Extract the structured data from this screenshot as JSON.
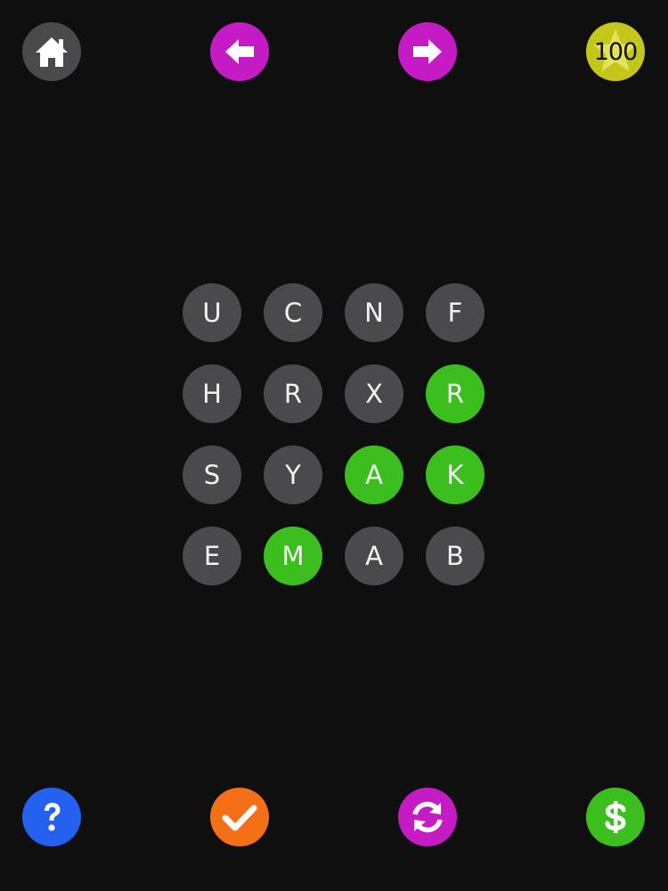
{
  "colors": {
    "background": "#0f0f10",
    "tile_default": "#4a494c",
    "tile_selected": "#3cbe1f",
    "home": "#4a494c",
    "arrows": "#c41bc4",
    "coins": "#c4c61a",
    "help": "#2561f0",
    "submit": "#f56f17",
    "shuffle": "#c41bc4",
    "shop": "#3cbe1f",
    "icon": "#ffffff"
  },
  "top_bar": {
    "home_icon": "home-icon",
    "back_icon": "arrow-left-icon",
    "forward_icon": "arrow-right-icon",
    "coins_icon": "star-icon",
    "coins": "100"
  },
  "bottom_bar": {
    "help_icon": "question-icon",
    "submit_icon": "check-icon",
    "shuffle_icon": "refresh-icon",
    "shop_icon": "dollar-icon"
  },
  "grid": {
    "rows": [
      [
        {
          "letter": "U",
          "selected": false
        },
        {
          "letter": "C",
          "selected": false
        },
        {
          "letter": "N",
          "selected": false
        },
        {
          "letter": "F",
          "selected": false
        }
      ],
      [
        {
          "letter": "H",
          "selected": false
        },
        {
          "letter": "R",
          "selected": false
        },
        {
          "letter": "X",
          "selected": false
        },
        {
          "letter": "R",
          "selected": true
        }
      ],
      [
        {
          "letter": "S",
          "selected": false
        },
        {
          "letter": "Y",
          "selected": false
        },
        {
          "letter": "A",
          "selected": true
        },
        {
          "letter": "K",
          "selected": true
        }
      ],
      [
        {
          "letter": "E",
          "selected": false
        },
        {
          "letter": "M",
          "selected": true
        },
        {
          "letter": "A",
          "selected": false
        },
        {
          "letter": "B",
          "selected": false
        }
      ]
    ]
  }
}
